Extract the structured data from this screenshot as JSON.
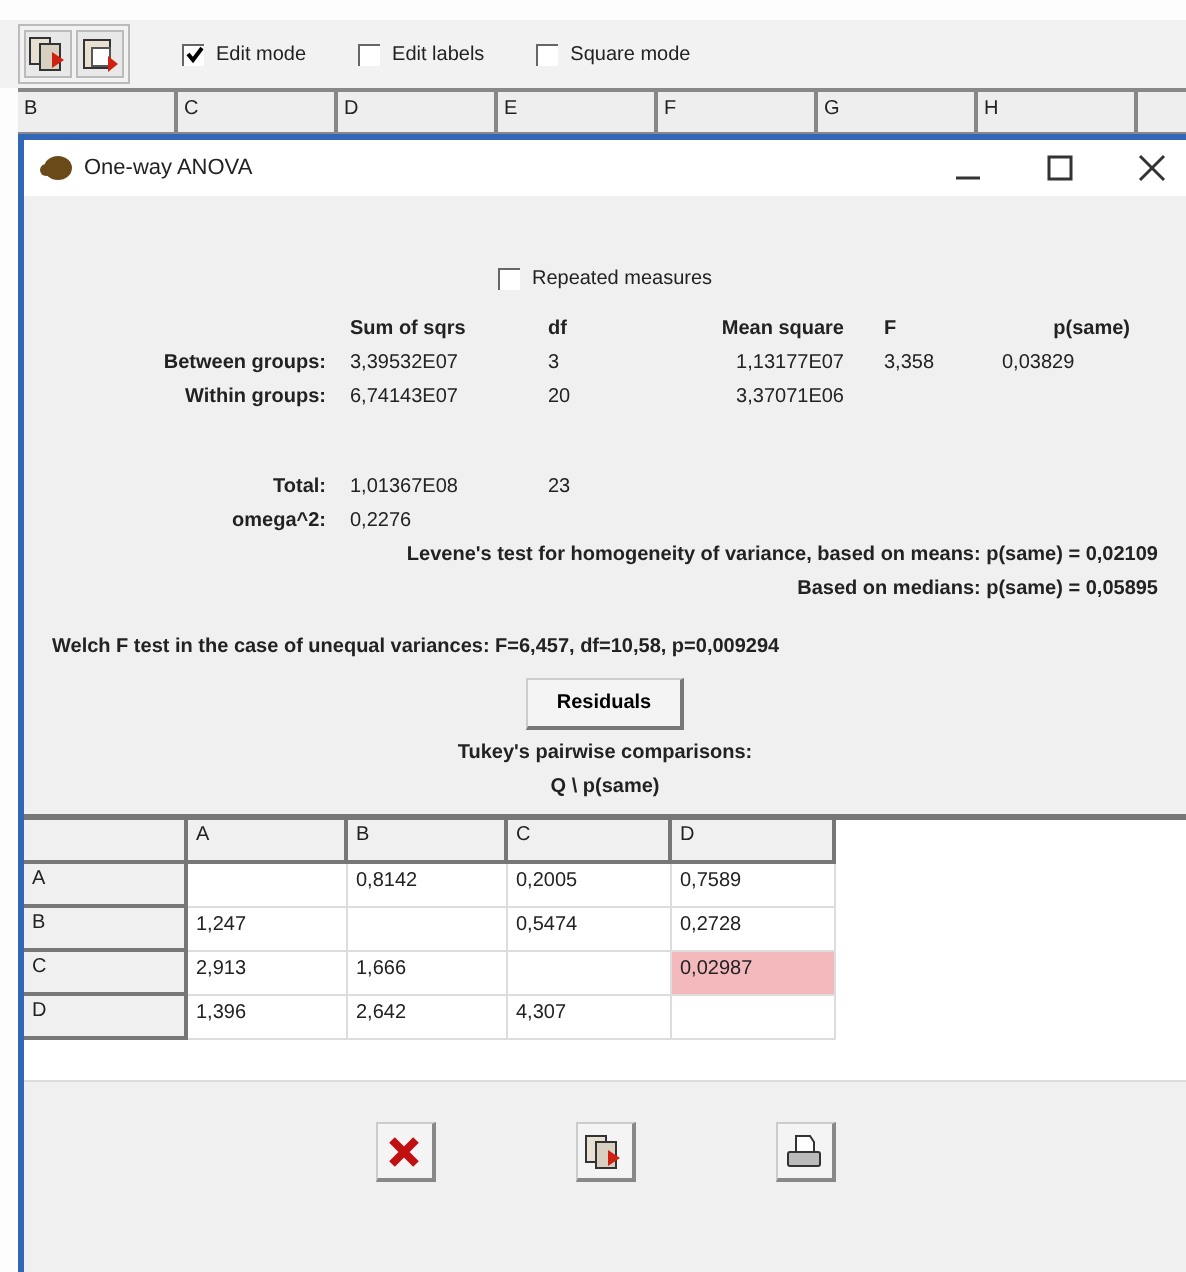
{
  "toolbar": {
    "buttons": [
      {
        "kind": "copy"
      },
      {
        "kind": "paste"
      }
    ],
    "checkboxes": [
      {
        "label": "Edit mode",
        "checked": true
      },
      {
        "label": "Edit labels",
        "checked": false
      },
      {
        "label": "Square mode",
        "checked": false
      }
    ]
  },
  "sheet_columns": [
    "B",
    "C",
    "D",
    "E",
    "F",
    "G",
    "H"
  ],
  "window": {
    "title": "One-way ANOVA"
  },
  "repeated_measures": {
    "label": "Repeated measures",
    "checked": false
  },
  "anova": {
    "columns": [
      "Sum of sqrs",
      "df",
      "Mean square",
      "F",
      "p(same)"
    ],
    "rows": [
      {
        "label": "Between groups:",
        "cells": [
          "3,39532E07",
          "3",
          "1,13177E07",
          "3,358",
          "0,03829"
        ]
      },
      {
        "label": "Within groups:",
        "cells": [
          "6,74143E07",
          "20",
          "3,37071E06",
          null,
          null
        ]
      },
      {
        "label": "Total:",
        "cells": [
          "1,01367E08",
          "23",
          null,
          null,
          null
        ]
      },
      {
        "label": "omega^2:",
        "cells": [
          "0,2276",
          null,
          null,
          null,
          null
        ]
      }
    ]
  },
  "levene": {
    "means": "Levene's test for homogeneity of variance, based on means: p(same) = 0,02109",
    "medians": "Based on medians: p(same) = 0,05895"
  },
  "welch": "Welch F test in the case of unequal variances: F=6,457, df=10,58, p=0,009294",
  "residuals_button": "Residuals",
  "tukey": {
    "title": "Tukey's pairwise comparisons:",
    "subtitle": "Q \\ p(same)",
    "columns": [
      "A",
      "B",
      "C",
      "D"
    ],
    "rows": [
      {
        "label": "A",
        "cells": [
          {
            "highlighted": false
          },
          {
            "value": "0,8142",
            "highlighted": false
          },
          {
            "value": "0,2005",
            "highlighted": false
          },
          {
            "value": "0,7589",
            "highlighted": false
          }
        ]
      },
      {
        "label": "B",
        "cells": [
          {
            "value": "1,247",
            "highlighted": false
          },
          {
            "highlighted": false
          },
          {
            "value": "0,5474",
            "highlighted": false
          },
          {
            "value": "0,2728",
            "highlighted": false
          }
        ]
      },
      {
        "label": "C",
        "cells": [
          {
            "value": "2,913",
            "highlighted": false
          },
          {
            "value": "1,666",
            "highlighted": false
          },
          {
            "highlighted": false
          },
          {
            "value": "0,02987",
            "highlighted": true
          }
        ]
      },
      {
        "label": "D",
        "cells": [
          {
            "value": "1,396",
            "highlighted": false
          },
          {
            "value": "2,642",
            "highlighted": false
          },
          {
            "value": "4,307",
            "highlighted": false
          },
          {
            "highlighted": false
          }
        ]
      }
    ]
  },
  "bottom_buttons": [
    {
      "kind": "close"
    },
    {
      "kind": "copy"
    },
    {
      "kind": "print"
    }
  ]
}
